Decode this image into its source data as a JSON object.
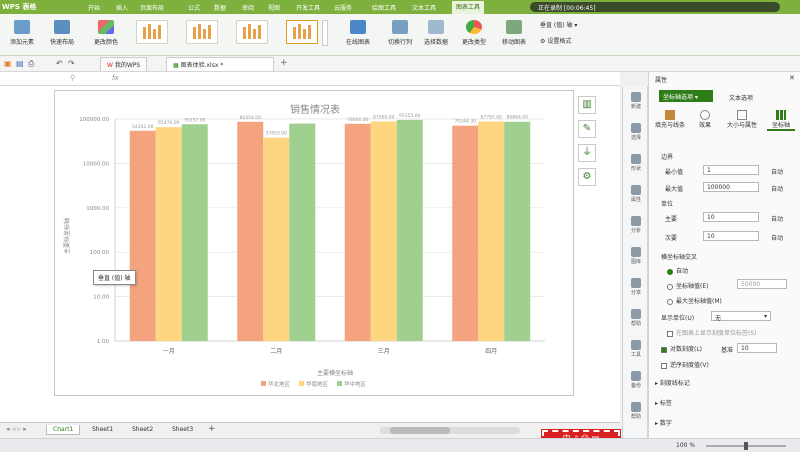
{
  "app": {
    "name": "WPS 表格",
    "ribbon_tabs": [
      "开始",
      "插入",
      "页面布局",
      "公式",
      "数据",
      "审阅",
      "视图",
      "开发工具",
      "云服务",
      "绘图工具",
      "文本工具",
      "图表工具"
    ],
    "active_ribbon_tab": "图表工具",
    "recording_label": "正在录制 [00:06:45]"
  },
  "ribbon": {
    "add_element": "添加元素",
    "quick_layout": "快速布局",
    "change_color": "更改颜色",
    "online_chart": "在线图表",
    "switch_rowcol": "切换行列",
    "select_data": "选择数据",
    "change_type": "更改类型",
    "move_chart": "移动图表",
    "axis_selector": "垂直 (值) 轴",
    "set_format": "设置格式"
  },
  "toolbar": {
    "doc_tabs": [
      {
        "label": "我的WPS"
      },
      {
        "label": "图表体验.xlsx *"
      }
    ],
    "fx_label": "fx"
  },
  "chart_data": {
    "type": "bar",
    "title": "销售情况表",
    "xlabel": "主要横坐标轴",
    "ylabel": "主要纵坐标轴",
    "categories": [
      "一月",
      "二月",
      "三月",
      "四月"
    ],
    "y_scale": "log",
    "ylim": [
      1,
      100000
    ],
    "y_ticks": [
      "1.00",
      "10.00",
      "100.00",
      "1000.00",
      "10000.00",
      "100000.00"
    ],
    "series": [
      {
        "name": "华北地区",
        "color": "#f4a37e",
        "values": [
          54342,
          86454,
          78006,
          70544.3
        ]
      },
      {
        "name": "华南地区",
        "color": "#ffd680",
        "values": [
          65470,
          37853,
          87966,
          87797
        ]
      },
      {
        "name": "华中地区",
        "color": "#9fd08f",
        "values": [
          76157,
          79000,
          95355,
          86864
        ]
      }
    ],
    "data_labels": [
      [
        "54342.00",
        "65476.00",
        "76157.00"
      ],
      [
        "86454.00",
        "37853.00",
        ""
      ],
      [
        "78006.00",
        "87966.00",
        "95355.00"
      ],
      [
        "70544.30",
        "87797.00",
        "86864.00"
      ]
    ],
    "legend_position": "bottom",
    "grid": true
  },
  "tooltip": "垂直 (值) 轴",
  "sheet_tabs": [
    "Chart1",
    "Sheet1",
    "Sheet2",
    "Sheet3"
  ],
  "active_sheet": "Chart1",
  "rail": [
    "新建",
    "选择",
    "形状",
    "属性",
    "分析",
    "图库",
    "分享",
    "帮助",
    "工具",
    "备份",
    "帮助"
  ],
  "props": {
    "header": "属性",
    "tabs": [
      "坐标轴选项",
      "文本选项"
    ],
    "subtabs": [
      "填充与线条",
      "效果",
      "大小与属性",
      "坐标轴"
    ],
    "bounds_label": "边界",
    "min_label": "最小值",
    "min_value": "1",
    "min_auto": "自动",
    "max_label": "最大值",
    "max_value": "100000",
    "max_auto": "自动",
    "units_label": "单位",
    "major_label": "主要",
    "major_value": "10",
    "major_auto": "自动",
    "minor_label": "次要",
    "minor_value": "10",
    "minor_auto": "自动",
    "cross_label": "横坐标轴交叉",
    "cross_auto": "自动",
    "cross_value_label": "坐标轴值(E)",
    "cross_value": "50000",
    "cross_max": "最大坐标轴值(M)",
    "display_units_label": "显示单位(U)",
    "display_units_value": "无",
    "show_units_label": "在图表上显示刻度单位标签(S)",
    "log_scale_label": "对数刻度(L)",
    "log_base_label": "基准",
    "log_base_value": "10",
    "reverse_label": "逆序刻度值(V)",
    "tick_marks": "刻度线标记",
    "labels": "标签",
    "number": "数字"
  },
  "status": {
    "zoom": "100 %"
  },
  "badge": "中 ♪ ☺ ▤"
}
